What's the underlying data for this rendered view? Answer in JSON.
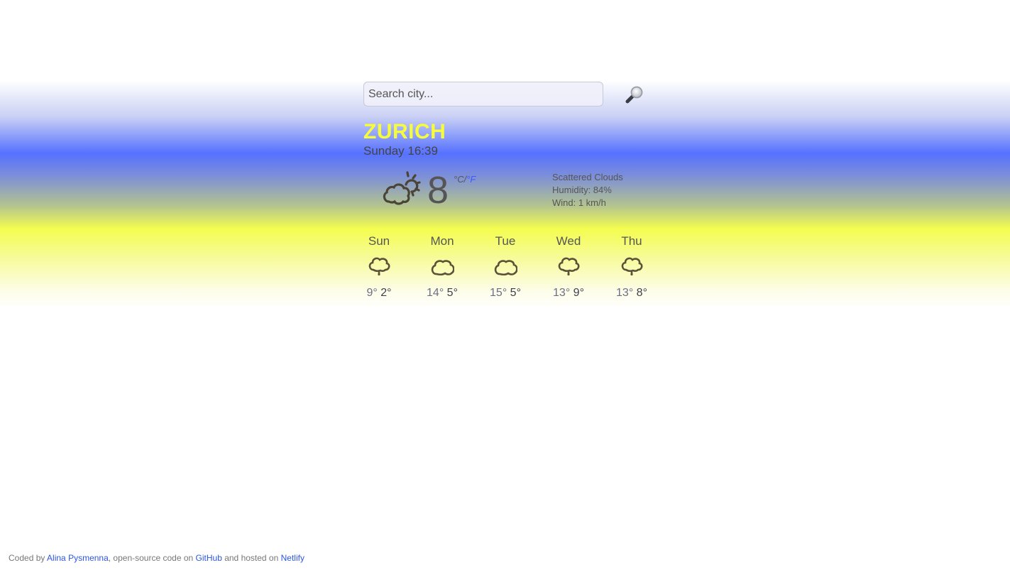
{
  "search": {
    "placeholder": "Search city...",
    "value": "",
    "button_icon": "magnifying-glass-icon"
  },
  "current": {
    "city": "ZURICH",
    "datetime": "Sunday 16:39",
    "icon": "partly-cloudy-icon",
    "temperature": "8",
    "unit_celsius": "°C",
    "unit_separator": "/",
    "unit_fahrenheit": "°F",
    "description": "Scattered Clouds",
    "humidity": "Humidity: 84%",
    "wind": "Wind: 1 km/h"
  },
  "forecast": [
    {
      "day": "Sun",
      "icon": "rain-cloud-icon",
      "max": "9°",
      "min": "2°"
    },
    {
      "day": "Mon",
      "icon": "cloud-icon",
      "max": "14°",
      "min": "5°"
    },
    {
      "day": "Tue",
      "icon": "cloud-icon",
      "max": "15°",
      "min": "5°"
    },
    {
      "day": "Wed",
      "icon": "rain-cloud-icon",
      "max": "13°",
      "min": "9°"
    },
    {
      "day": "Thu",
      "icon": "rain-cloud-icon",
      "max": "13°",
      "min": "8°"
    }
  ],
  "footer": {
    "prefix": "Coded by ",
    "author": "Alina Pysmenna",
    "middle": ", open-source code on ",
    "github": "GitHub",
    "middle2": " and hosted on ",
    "netlify": "Netlify"
  },
  "colors": {
    "accent_blue": "#5671ff",
    "accent_yellow": "#f6fb3c",
    "link": "#2d56e0"
  }
}
